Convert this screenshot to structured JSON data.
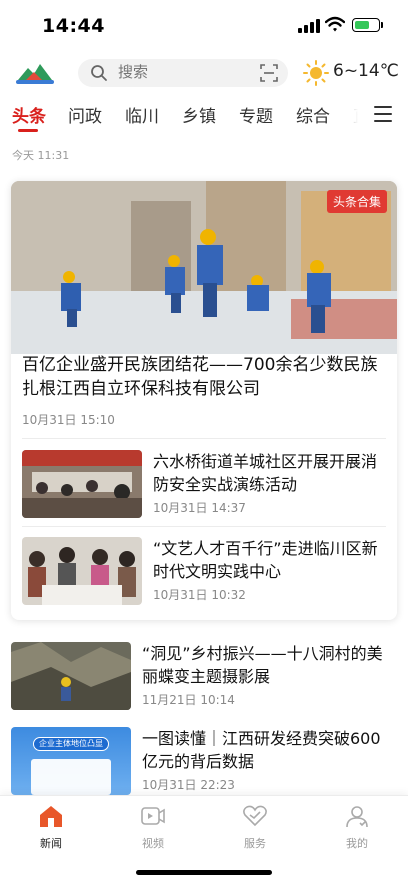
{
  "status_bar": {
    "time": "14:44"
  },
  "top_bar": {
    "search_placeholder": "搜索",
    "weather": {
      "temp": "6~14℃",
      "icon": "sun-icon"
    }
  },
  "tabs": [
    {
      "label": "头条",
      "active": true
    },
    {
      "label": "问政"
    },
    {
      "label": "临川"
    },
    {
      "label": "乡镇"
    },
    {
      "label": "专题"
    },
    {
      "label": "综合"
    },
    {
      "label": "直"
    }
  ],
  "date_label": "今天 11:31",
  "hero": {
    "badge": "头条合集",
    "title": "百亿企业盛开民族团结花——700余名少数民族扎根江西自立环保科技有限公司",
    "time": "10月31日 15:10"
  },
  "card_items": [
    {
      "title": "六水桥街道羊城社区开展开展消防安全实战演练活动",
      "time": "10月31日 14:37"
    },
    {
      "title": "“文艺人才百千行”走进临川区新时代文明实践中心",
      "time": "10月31日 10:32"
    }
  ],
  "feed": [
    {
      "title": "“洞见”乡村振兴——十八洞村的美丽蝶变主题摄影展",
      "time": "11月21日 10:14"
    },
    {
      "title": "一图读懂｜江西研发经费突破600亿元的背后数据",
      "time": "10月31日 22:23",
      "thumb_text": "企业主体地位凸显"
    }
  ],
  "bottom_nav": [
    {
      "label": "新闻",
      "icon": "home-icon",
      "active": true
    },
    {
      "label": "视频",
      "icon": "video-icon"
    },
    {
      "label": "服务",
      "icon": "heart-icon"
    },
    {
      "label": "我的",
      "icon": "user-icon"
    }
  ],
  "colors": {
    "accent": "#d9201c",
    "badge": "#e03a32"
  }
}
